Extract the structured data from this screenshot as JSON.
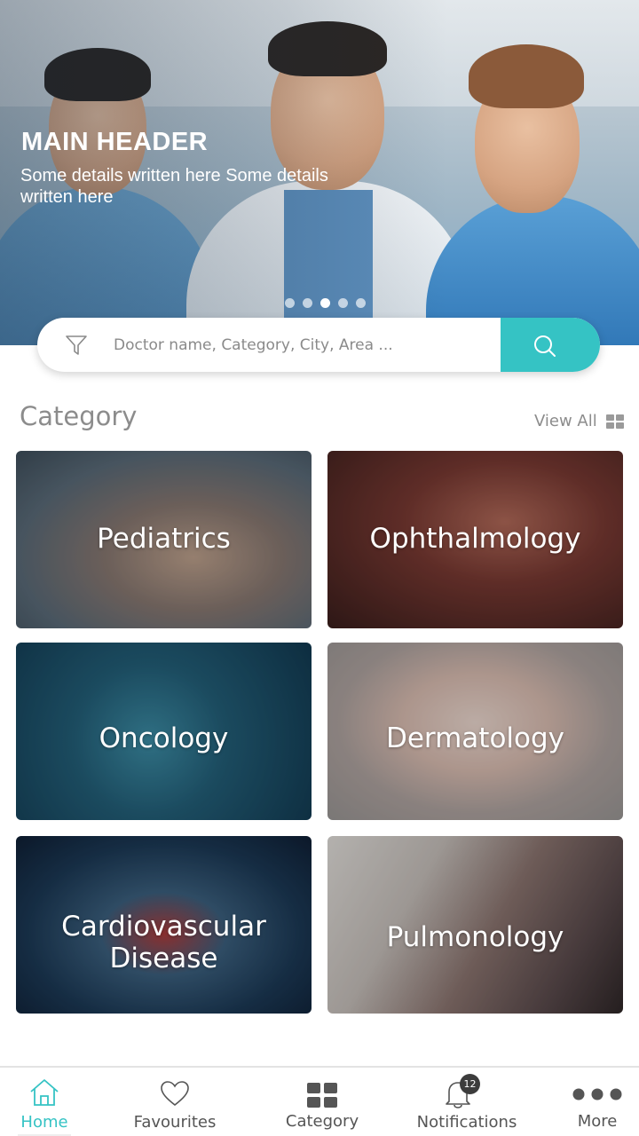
{
  "hero": {
    "title": "MAIN HEADER",
    "subtitle": "Some details written here Some details written here",
    "slides_total": 5,
    "active_slide": 3
  },
  "search": {
    "placeholder": "Doctor name, Category, City, Area ..."
  },
  "category_section": {
    "title": "Category",
    "view_all_label": "View All"
  },
  "categories": [
    {
      "label": "Pediatrics"
    },
    {
      "label": "Ophthalmology"
    },
    {
      "label": "Oncology"
    },
    {
      "label": "Dermatology"
    },
    {
      "label": "Cardiovascular Disease"
    },
    {
      "label": "Pulmonology"
    }
  ],
  "bottom_nav": {
    "items": [
      {
        "label": "Home",
        "icon": "home-icon",
        "active": true
      },
      {
        "label": "Favourites",
        "icon": "heart-icon",
        "active": false
      },
      {
        "label": "Category",
        "icon": "grid-icon",
        "active": false
      },
      {
        "label": "Notifications",
        "icon": "bell-icon",
        "active": false,
        "badge": "12"
      },
      {
        "label": "More",
        "icon": "more-dots-icon",
        "active": false
      }
    ]
  },
  "colors": {
    "accent": "#35c3c4",
    "text_muted": "#8c8c8c"
  }
}
